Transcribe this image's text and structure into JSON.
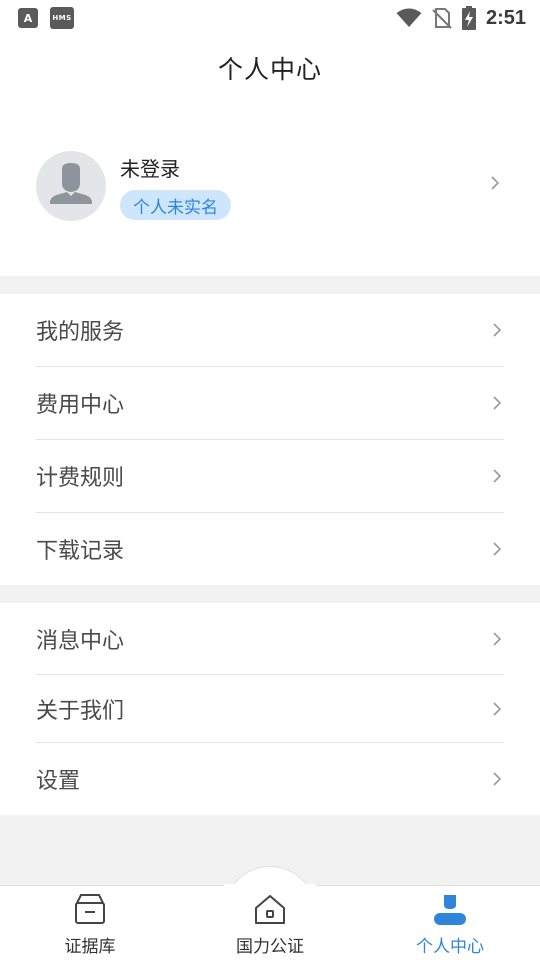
{
  "status_bar": {
    "app_icon_1": "A",
    "app_icon_2": "HMS",
    "time": "2:51",
    "icons": [
      "wifi-icon",
      "no-sim-icon",
      "battery-charging-icon"
    ]
  },
  "header": {
    "title": "个人中心"
  },
  "profile": {
    "name": "未登录",
    "badge": "个人未实名",
    "avatar_icon": "default-avatar-icon"
  },
  "menu_group_1": [
    {
      "label": "我的服务"
    },
    {
      "label": "费用中心"
    },
    {
      "label": "计费规则"
    },
    {
      "label": "下载记录"
    }
  ],
  "menu_group_2": [
    {
      "label": "消息中心"
    },
    {
      "label": "关于我们"
    },
    {
      "label": "设置"
    }
  ],
  "tabbar": {
    "tabs": [
      {
        "label": "证据库",
        "icon": "archive-box-icon",
        "active": false
      },
      {
        "label": "国力公证",
        "icon": "home-icon",
        "active": false
      },
      {
        "label": "个人中心",
        "icon": "person-icon",
        "active": true
      }
    ],
    "active_color": "#2f86d9"
  },
  "colors": {
    "accent": "#2f86d9",
    "badge_bg": "#cde6fb",
    "page_bg": "#f2f2f2"
  }
}
